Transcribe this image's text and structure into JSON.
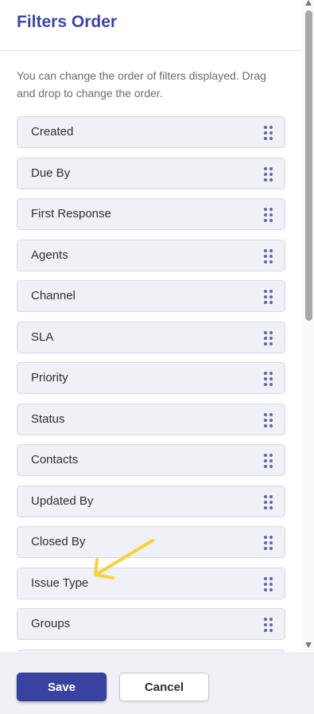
{
  "header": {
    "title": "Filters Order"
  },
  "description": "You can change the order of filters displayed. Drag and drop to change the order.",
  "filters": [
    {
      "label": "Created"
    },
    {
      "label": "Due By"
    },
    {
      "label": "First Response"
    },
    {
      "label": "Agents"
    },
    {
      "label": "Channel"
    },
    {
      "label": "SLA"
    },
    {
      "label": "Priority"
    },
    {
      "label": "Status"
    },
    {
      "label": "Contacts"
    },
    {
      "label": "Updated By"
    },
    {
      "label": "Closed By"
    },
    {
      "label": "Issue Type"
    },
    {
      "label": "Groups"
    },
    {
      "label": ""
    }
  ],
  "icons": {
    "drag_handle": "drag-handle-icon",
    "annotation": "arrow-icon"
  },
  "footer": {
    "save_label": "Save",
    "cancel_label": "Cancel"
  },
  "colors": {
    "accent": "#3a42a0",
    "title": "#3b46a3",
    "item_bg": "#f0f0f7",
    "drag_dots": "#5d66a8",
    "annotation": "#f5d23a"
  }
}
